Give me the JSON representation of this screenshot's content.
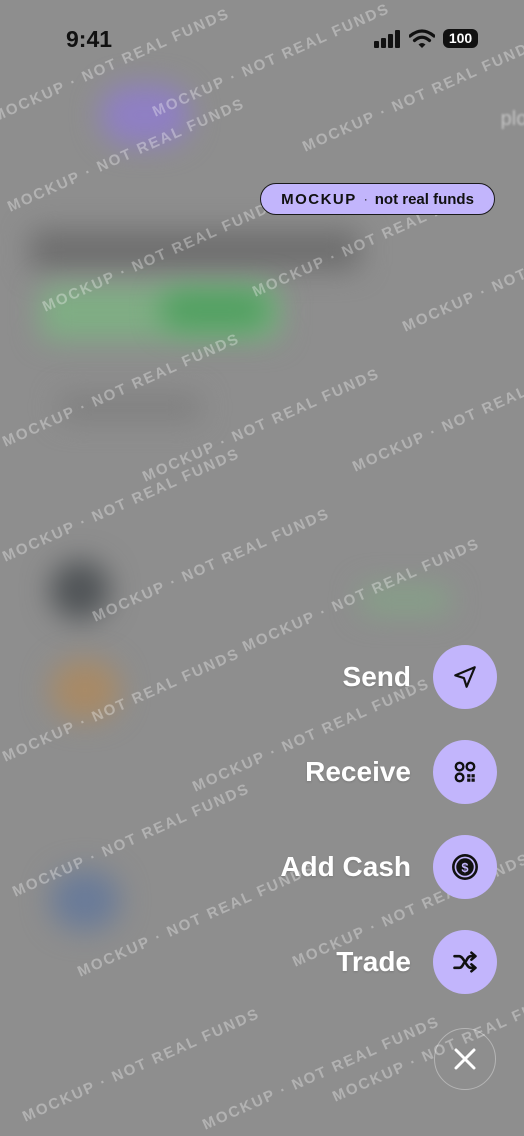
{
  "status_bar": {
    "time": "9:41",
    "battery": "100"
  },
  "background": {
    "partial_text": "plor"
  },
  "badge": {
    "strong": "MOCKUP",
    "separator": "·",
    "rest": "not real funds"
  },
  "watermark_text": "MOCKUP · NOT REAL FUNDS",
  "actions": [
    {
      "label": "Send",
      "icon": "send-icon"
    },
    {
      "label": "Receive",
      "icon": "qr-code-icon"
    },
    {
      "label": "Add Cash",
      "icon": "dollar-circle-icon"
    },
    {
      "label": "Trade",
      "icon": "shuffle-icon"
    }
  ],
  "close": {
    "icon": "close-icon"
  },
  "colors": {
    "accent": "#c2b5fc",
    "overlay": "#8e8e8e"
  }
}
